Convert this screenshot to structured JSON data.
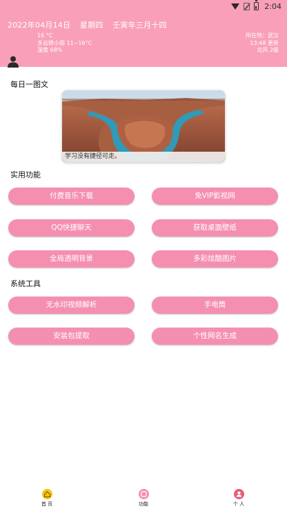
{
  "status_bar": {
    "time": "2:04"
  },
  "header": {
    "date": "2022年04月14日",
    "weekday": "星期四",
    "lunar": "壬寅年三月十四",
    "temperature": "16 °C",
    "weather": "多云转小雨 11~16°C",
    "humidity": "湿度 68%",
    "location": "所在地：武汉",
    "updated": "13:48 更新",
    "wind": "北风 2级"
  },
  "daily": {
    "title": "每日一图文",
    "caption": "学习没有捷径可走。"
  },
  "practical": {
    "title": "实用功能",
    "buttons": [
      "付费音乐下载",
      "免VIP影视网",
      "QQ快捷聊天",
      "获取桌面壁纸",
      "全局透明背景",
      "多彩炫酷图片"
    ]
  },
  "system": {
    "title": "系统工具",
    "buttons": [
      "无水印视频解析",
      "手电筒",
      "安装包提取",
      "个性网名生成"
    ]
  },
  "nav": {
    "items": [
      {
        "label": "首 页",
        "icon": "home-icon",
        "color": "#f5c518"
      },
      {
        "label": "功能",
        "icon": "function-icon",
        "color": "#f48fb0"
      },
      {
        "label": "个 人",
        "icon": "person-icon",
        "color": "#e85a7a"
      }
    ]
  },
  "colors": {
    "header": "#f9a0b8",
    "button": "#f48fb0"
  }
}
